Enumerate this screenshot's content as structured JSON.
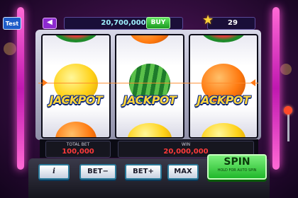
{
  "test_button": "Test",
  "header": {
    "back_icon": "left-arrow-icon",
    "coins": "20,700,000",
    "buy_label": "BUY",
    "level": "29",
    "level_icon": "star-icon"
  },
  "reels": [
    {
      "jackpot": "JACKPOT",
      "fruits": [
        "watermelon",
        "lemon",
        "orange"
      ]
    },
    {
      "jackpot": "JACKPOT",
      "fruits": [
        "orange",
        "watermelon",
        "lemon"
      ]
    },
    {
      "jackpot": "JACKPOT",
      "fruits": [
        "watermelon",
        "orange",
        "lemon"
      ]
    }
  ],
  "info": {
    "total_bet_label": "TOTAL BET",
    "total_bet": "100,000",
    "win_label": "WIN",
    "win": "20,000,000"
  },
  "controls": {
    "info_label": "i",
    "bet_minus_label": "BET−",
    "bet_plus_label": "BET+",
    "max_label": "MAX",
    "spin_label": "SPIN",
    "spin_sub": "HOLD FOR AUTO SPIN"
  },
  "colors": {
    "jackpot_text": "#ffd53a",
    "win_value": "#ff3a3a",
    "neon_frame": "#ff4fd8",
    "spin_button": "#20b82a"
  }
}
